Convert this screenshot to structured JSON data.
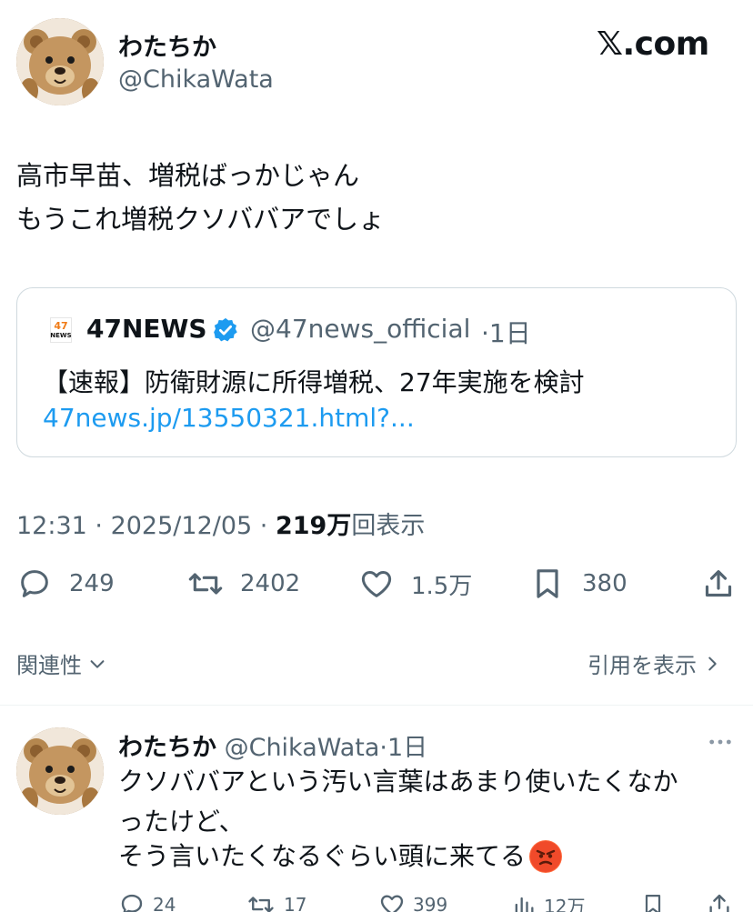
{
  "tweet": {
    "author_name": "わたちか",
    "author_handle": "@ChikaWata",
    "brand": "𝕏.com",
    "text_line1": "高市早苗、増税ばっかじゃん",
    "text_line2": "もうこれ増税クソババアでしょ",
    "quote": {
      "logo_number": "47",
      "logo_word": "NEWS",
      "name": "47NEWS",
      "handle": "@47news_official",
      "time": "·1日",
      "text": "【速報】防衛財源に所得増税、27年実施を検討",
      "link": "47news.jp/13550321.html?..."
    },
    "time": "12:31",
    "date": "2025/12/05",
    "views_count": "219万",
    "views_label": "回表示",
    "actions": {
      "replies": "249",
      "retweets": "2402",
      "likes": "1.5万",
      "bookmarks": "380"
    },
    "related_label": "関連性",
    "quotes_label": "引用を表示"
  },
  "reply": {
    "author_name": "わたちか",
    "author_handle": "@ChikaWata",
    "time": "·1日",
    "line1": "クソババアという汚い言葉はあまり使いたくなか",
    "line2": "ったけど、",
    "line3": "そう言いたくなるぐらい頭に来てる",
    "emoji": "😡",
    "actions": {
      "replies": "24",
      "retweets": "17",
      "likes": "399",
      "views": "12万"
    }
  },
  "colors": {
    "text": "#0f1419",
    "secondary": "#536471",
    "link": "#1d9bf0",
    "verified": "#1d9bf0",
    "border": "#cfd9de"
  }
}
